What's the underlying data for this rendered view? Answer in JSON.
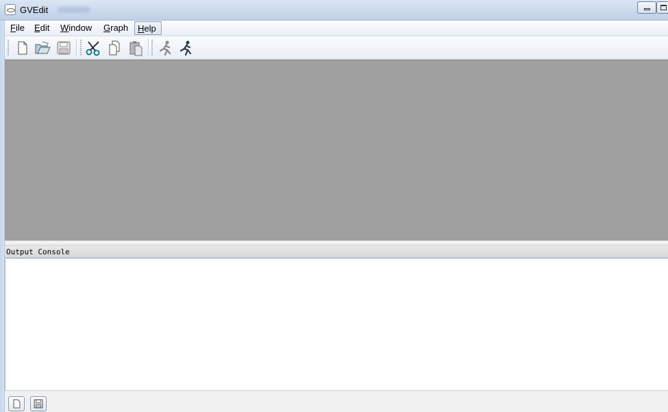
{
  "window": {
    "title": "GVEdit"
  },
  "menu": {
    "items": [
      {
        "accel": "F",
        "rest": "ile"
      },
      {
        "accel": "E",
        "rest": "dit"
      },
      {
        "accel": "W",
        "rest": "indow"
      },
      {
        "accel": "G",
        "rest": "raph"
      },
      {
        "accel": "H",
        "rest": "elp"
      }
    ]
  },
  "toolbar": {
    "buttons": [
      "new-file-icon",
      "open-folder-icon",
      "save-disk-icon",
      "cut-scissors-icon",
      "copy-icon",
      "paste-icon",
      "layout-runner-icon",
      "run-runner-icon"
    ]
  },
  "console": {
    "title": "Output Console"
  },
  "colors": {
    "mdi_background": "#a0a0a0",
    "console_background": "#ffffff",
    "chrome": "#f0f0f0"
  }
}
